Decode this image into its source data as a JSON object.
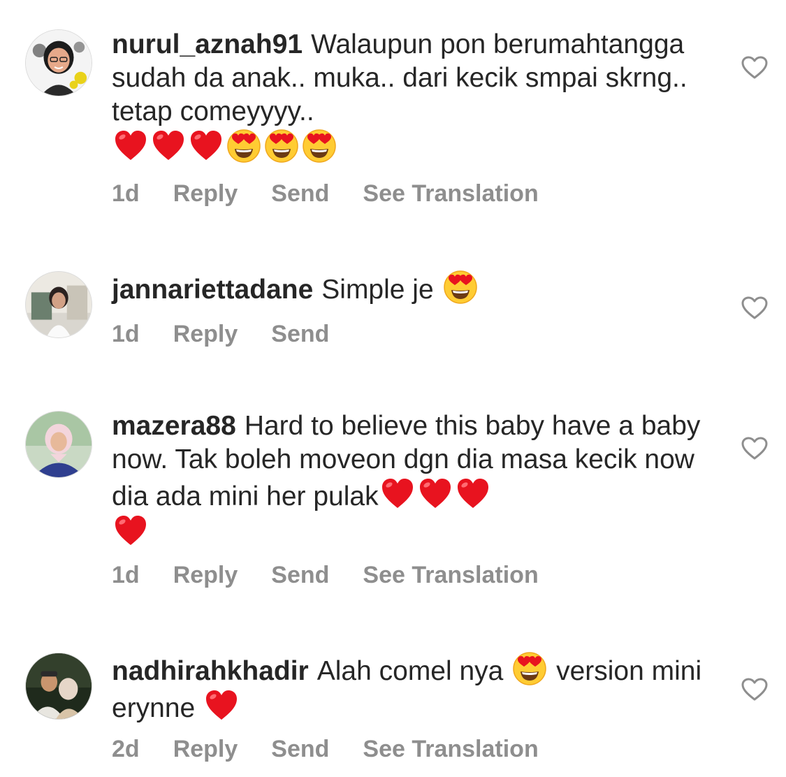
{
  "comments": [
    {
      "username": "nurul_aznah91",
      "text_before": "Walaupun pon berumahtangga sudah da anak.. muka.. dari kecik smpai skrng.. tetap comeyyyy..",
      "emojis": [
        "heart-emoji",
        "heart-emoji",
        "heart-emoji",
        "heart-eyes-emoji",
        "heart-eyes-emoji",
        "heart-eyes-emoji"
      ],
      "time": "1d",
      "reply": "Reply",
      "send": "Send",
      "translate": "See Translation"
    },
    {
      "username": "jannariettadane",
      "text_before": "Simple je",
      "emojis": [
        "heart-eyes-emoji"
      ],
      "time": "1d",
      "reply": "Reply",
      "send": "Send"
    },
    {
      "username": "mazera88",
      "text_before": "Hard to believe this baby have a baby now. Tak boleh moveon dgn dia masa kecik now dia ada mini her pulak",
      "emojis": [
        "heart-emoji",
        "heart-emoji",
        "heart-emoji",
        "heart-emoji"
      ],
      "time": "1d",
      "reply": "Reply",
      "send": "Send",
      "translate": "See Translation"
    },
    {
      "username": "nadhirahkhadir",
      "text_before": "Alah comel nya",
      "emoji_mid": "heart-eyes-emoji",
      "text_after": "version mini erynne",
      "emojis": [
        "heart-emoji"
      ],
      "time": "2d",
      "reply": "Reply",
      "send": "Send",
      "translate": "See Translation"
    }
  ],
  "icons": {
    "like": "heart-outline-icon"
  },
  "colors": {
    "text": "#262626",
    "meta": "#8e8e8e",
    "heart": "#ed1c24"
  }
}
